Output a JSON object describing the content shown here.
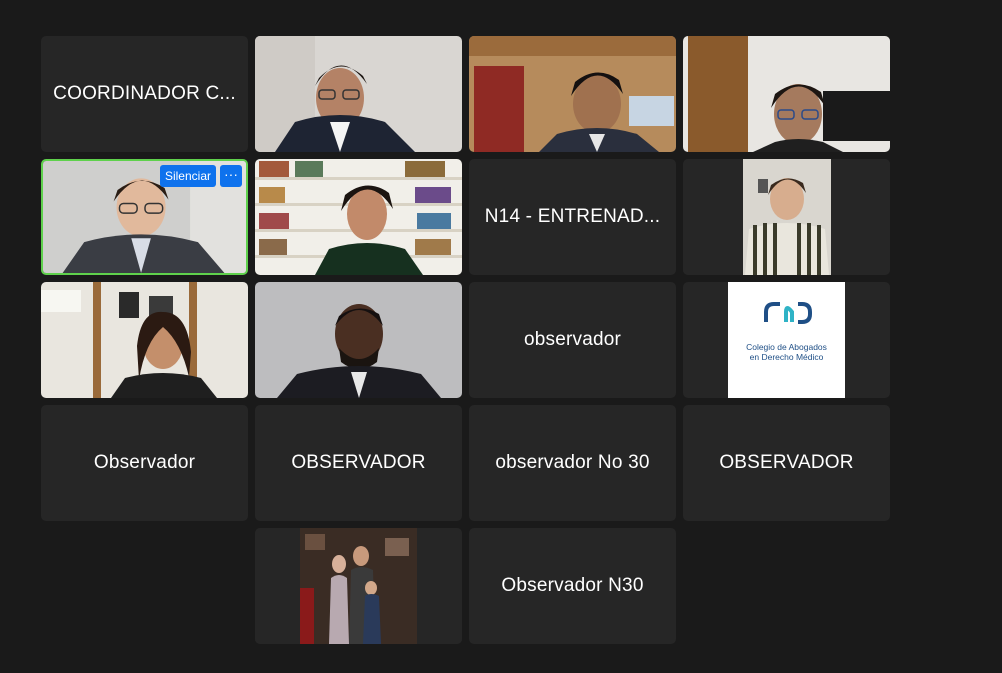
{
  "gallery": {
    "tiles": [
      {
        "name": "COORDINADOR C..."
      },
      {
        "name": "participant video"
      },
      {
        "name": "participant video"
      },
      {
        "name": "participant video"
      },
      {
        "name": "active speaker video"
      },
      {
        "name": "participant video"
      },
      {
        "name": "N14 - ENTRENAD..."
      },
      {
        "name": "participant video"
      },
      {
        "name": "participant video"
      },
      {
        "name": "participant video"
      },
      {
        "name": "observador"
      },
      {
        "name": "logo"
      },
      {
        "name": "Observador"
      },
      {
        "name": "OBSERVADOR"
      },
      {
        "name": "observador No 30"
      },
      {
        "name": "OBSERVADOR"
      },
      {
        "name": "participant photo"
      },
      {
        "name": "Observador N30"
      }
    ],
    "active_tile": {
      "mute_label": "Silenciar",
      "more_label": "···"
    },
    "logo": {
      "line1": "Colegio de Abogados",
      "line2": "en Derecho Médico",
      "accent": "#1f4f86",
      "accent2": "#2fb3c6"
    }
  },
  "colors": {
    "background": "#1a1a1a",
    "tile": "#262626",
    "active_border": "#5fd14c",
    "button": "#0e72ed"
  }
}
